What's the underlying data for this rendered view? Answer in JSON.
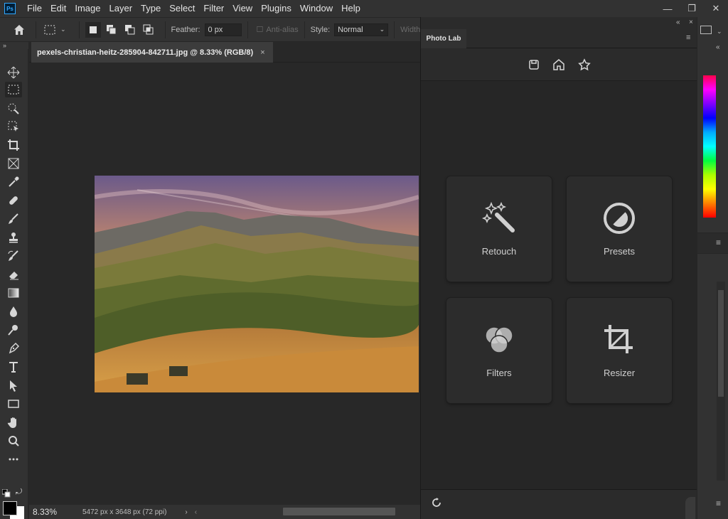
{
  "app": {
    "logo": "Ps"
  },
  "menubar": {
    "items": [
      "File",
      "Edit",
      "Image",
      "Layer",
      "Type",
      "Select",
      "Filter",
      "View",
      "Plugins",
      "Window",
      "Help"
    ]
  },
  "window_controls": {
    "minimize": "—",
    "restore": "❐",
    "close": "✕"
  },
  "options": {
    "feather_label": "Feather:",
    "feather_value": "0 px",
    "antialias_label": "Anti-alias",
    "style_label": "Style:",
    "style_value": "Normal",
    "width_label": "Width:"
  },
  "document": {
    "tab_title": "pexels-christian-heitz-285904-842711.jpg @ 8.33% (RGB/8)",
    "close": "×"
  },
  "status": {
    "zoom": "8.33%",
    "dimensions": "5472 px x 3648 px (72 ppi)"
  },
  "plugin": {
    "tab_title": "Photo Lab",
    "cards": [
      {
        "label": "Retouch",
        "icon": "magic-wand-icon"
      },
      {
        "label": "Presets",
        "icon": "presets-circle-icon"
      },
      {
        "label": "Filters",
        "icon": "filters-circles-icon"
      },
      {
        "label": "Resizer",
        "icon": "crop-icon"
      }
    ],
    "nav_icons": [
      "save-icon",
      "home-icon",
      "star-icon"
    ]
  },
  "colors": {
    "accent": "#31a8ff",
    "panel": "#323232",
    "canvas": "#282828"
  }
}
